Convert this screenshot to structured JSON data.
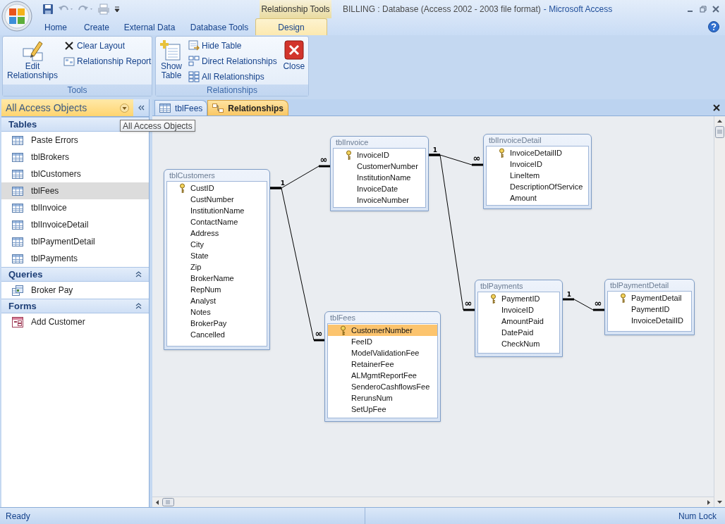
{
  "window": {
    "document": "BILLING : Database (Access 2002 - 2003 file format)",
    "app": "- Microsoft Access",
    "contextual_tab": "Relationship Tools"
  },
  "ribbon_tabs": [
    {
      "label": "Home",
      "selected": false
    },
    {
      "label": "Create",
      "selected": false
    },
    {
      "label": "External Data",
      "selected": false
    },
    {
      "label": "Database Tools",
      "selected": false
    },
    {
      "label": "Design",
      "selected": true
    }
  ],
  "ribbon_groups": [
    {
      "label": "Tools",
      "buttons": [
        {
          "label": "Edit Relationships",
          "kind": "large"
        },
        {
          "label": "Clear Layout",
          "kind": "small"
        },
        {
          "label": "Relationship Report",
          "kind": "small"
        }
      ]
    },
    {
      "label": "Relationships",
      "buttons": [
        {
          "label": "Show Table",
          "kind": "large"
        },
        {
          "label": "Hide Table",
          "kind": "small"
        },
        {
          "label": "Direct Relationships",
          "kind": "small"
        },
        {
          "label": "All Relationships",
          "kind": "small"
        },
        {
          "label": "Close",
          "kind": "large"
        }
      ]
    }
  ],
  "nav": {
    "title": "All Access Objects",
    "tooltip": "All Access Objects",
    "groups": [
      {
        "label": "Tables",
        "items": [
          {
            "label": "Paste Errors",
            "kind": "table",
            "selected": false
          },
          {
            "label": "tblBrokers",
            "kind": "table",
            "selected": false
          },
          {
            "label": "tblCustomers",
            "kind": "table",
            "selected": false
          },
          {
            "label": "tblFees",
            "kind": "table",
            "selected": true
          },
          {
            "label": "tblInvoice",
            "kind": "table",
            "selected": false
          },
          {
            "label": "tblInvoiceDetail",
            "kind": "table",
            "selected": false
          },
          {
            "label": "tblPaymentDetail",
            "kind": "table",
            "selected": false
          },
          {
            "label": "tblPayments",
            "kind": "table",
            "selected": false
          }
        ]
      },
      {
        "label": "Queries",
        "items": [
          {
            "label": "Broker Pay",
            "kind": "query",
            "selected": false
          }
        ]
      },
      {
        "label": "Forms",
        "items": [
          {
            "label": "Add Customer",
            "kind": "form",
            "selected": false
          }
        ]
      }
    ]
  },
  "doc_tabs": [
    {
      "label": "tblFees",
      "kind": "table",
      "selected": false
    },
    {
      "label": "Relationships",
      "kind": "relationships",
      "selected": true
    }
  ],
  "tables": [
    {
      "name": "tblCustomers",
      "fields": [
        {
          "name": "CustID",
          "key": true,
          "selected": false
        },
        {
          "name": "CustNumber",
          "key": false,
          "selected": false
        },
        {
          "name": "InstitutionName",
          "key": false,
          "selected": false
        },
        {
          "name": "ContactName",
          "key": false,
          "selected": false
        },
        {
          "name": "Address",
          "key": false,
          "selected": false
        },
        {
          "name": "City",
          "key": false,
          "selected": false
        },
        {
          "name": "State",
          "key": false,
          "selected": false
        },
        {
          "name": "Zip",
          "key": false,
          "selected": false
        },
        {
          "name": "BrokerName",
          "key": false,
          "selected": false
        },
        {
          "name": "RepNum",
          "key": false,
          "selected": false
        },
        {
          "name": "Analyst",
          "key": false,
          "selected": false
        },
        {
          "name": "Notes",
          "key": false,
          "selected": false
        },
        {
          "name": "BrokerPay",
          "key": false,
          "selected": false
        },
        {
          "name": "Cancelled",
          "key": false,
          "selected": false
        }
      ]
    },
    {
      "name": "tblInvoice",
      "fields": [
        {
          "name": "InvoiceID",
          "key": true,
          "selected": false
        },
        {
          "name": "CustomerNumber",
          "key": false,
          "selected": false
        },
        {
          "name": "InstitutionName",
          "key": false,
          "selected": false
        },
        {
          "name": "InvoiceDate",
          "key": false,
          "selected": false
        },
        {
          "name": "InvoiceNumber",
          "key": false,
          "selected": false
        }
      ]
    },
    {
      "name": "tblInvoiceDetail",
      "fields": [
        {
          "name": "InvoiceDetailID",
          "key": true,
          "selected": false
        },
        {
          "name": "InvoiceID",
          "key": false,
          "selected": false
        },
        {
          "name": "LineItem",
          "key": false,
          "selected": false
        },
        {
          "name": "DescriptionOfService",
          "key": false,
          "selected": false
        },
        {
          "name": "Amount",
          "key": false,
          "selected": false
        }
      ]
    },
    {
      "name": "tblFees",
      "fields": [
        {
          "name": "CustomerNumber",
          "key": true,
          "selected": true
        },
        {
          "name": "FeeID",
          "key": false,
          "selected": false
        },
        {
          "name": "ModelValidationFee",
          "key": false,
          "selected": false
        },
        {
          "name": "RetainerFee",
          "key": false,
          "selected": false
        },
        {
          "name": "ALMgmtReportFee",
          "key": false,
          "selected": false
        },
        {
          "name": "SenderoCashflowsFee",
          "key": false,
          "selected": false
        },
        {
          "name": "RerunsNum",
          "key": false,
          "selected": false
        },
        {
          "name": "SetUpFee",
          "key": false,
          "selected": false
        }
      ]
    },
    {
      "name": "tblPayments",
      "fields": [
        {
          "name": "PaymentID",
          "key": true,
          "selected": false
        },
        {
          "name": "InvoiceID",
          "key": false,
          "selected": false
        },
        {
          "name": "AmountPaid",
          "key": false,
          "selected": false
        },
        {
          "name": "DatePaid",
          "key": false,
          "selected": false
        },
        {
          "name": "CheckNum",
          "key": false,
          "selected": false
        }
      ]
    },
    {
      "name": "tblPaymentDetail",
      "fields": [
        {
          "name": "PaymentDetail",
          "key": true,
          "selected": false
        },
        {
          "name": "PaymentID",
          "key": false,
          "selected": false
        },
        {
          "name": "InvoiceDetailID",
          "key": false,
          "selected": false
        }
      ]
    }
  ],
  "relationships": [
    {
      "one": "1",
      "many": "∞"
    },
    {
      "many": "∞"
    },
    {
      "one": "1",
      "many": "∞"
    },
    {
      "many": "∞"
    },
    {
      "one": "1",
      "many": "∞"
    }
  ],
  "status_bar": {
    "left": "Ready",
    "right": "Num Lock"
  }
}
